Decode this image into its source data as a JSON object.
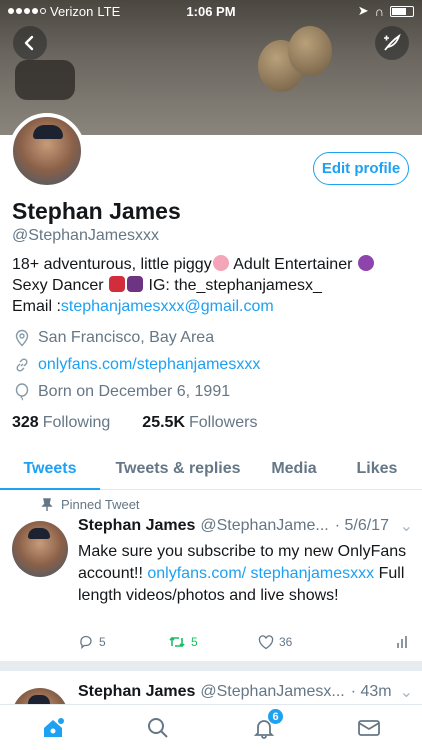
{
  "status_bar": {
    "carrier": "Verizon",
    "network": "LTE",
    "time": "1:06 PM"
  },
  "profile": {
    "name": "Stephan James",
    "handle": "@StephanJamesxxx",
    "edit_label": "Edit profile",
    "bio": {
      "line1_a": "18+ adventurous, little piggy",
      "line1_b": " Adult Entertainer ",
      "line2_a": "Sexy Dancer ",
      "line2_b": " IG: the_stephanjamesx_",
      "line3_label": "Email :",
      "line3_email": "stephanjamesxxx@gmail.com"
    },
    "location": "San Francisco, Bay Area",
    "website": "onlyfans.com/stephanjamesxxx",
    "birthday": "Born on December 6, 1991",
    "following_count": "328",
    "following_label": "Following",
    "followers_count": "25.5K",
    "followers_label": "Followers"
  },
  "tabs": [
    "Tweets",
    "Tweets & replies",
    "Media",
    "Likes"
  ],
  "pinned_label": "Pinned Tweet",
  "tweets": [
    {
      "name": "Stephan James",
      "handle": "@StephanJame...",
      "time": "· 5/6/17",
      "text_a": "Make sure you subscribe to my new OnlyFans account!! ",
      "text_link": "onlyfans.com/ stephanjamesxxx",
      "text_b": " Full length videos/photos and live shows!",
      "replies": "5",
      "retweets": "5",
      "likes": "36"
    },
    {
      "name": "Stephan James",
      "handle": "@StephanJamesx...",
      "time": "· 43m"
    }
  ],
  "nav": {
    "notifications_badge": "6"
  },
  "colors": {
    "accent": "#1da1f2",
    "retweet": "#17bf63",
    "secondary_text": "#657786"
  }
}
